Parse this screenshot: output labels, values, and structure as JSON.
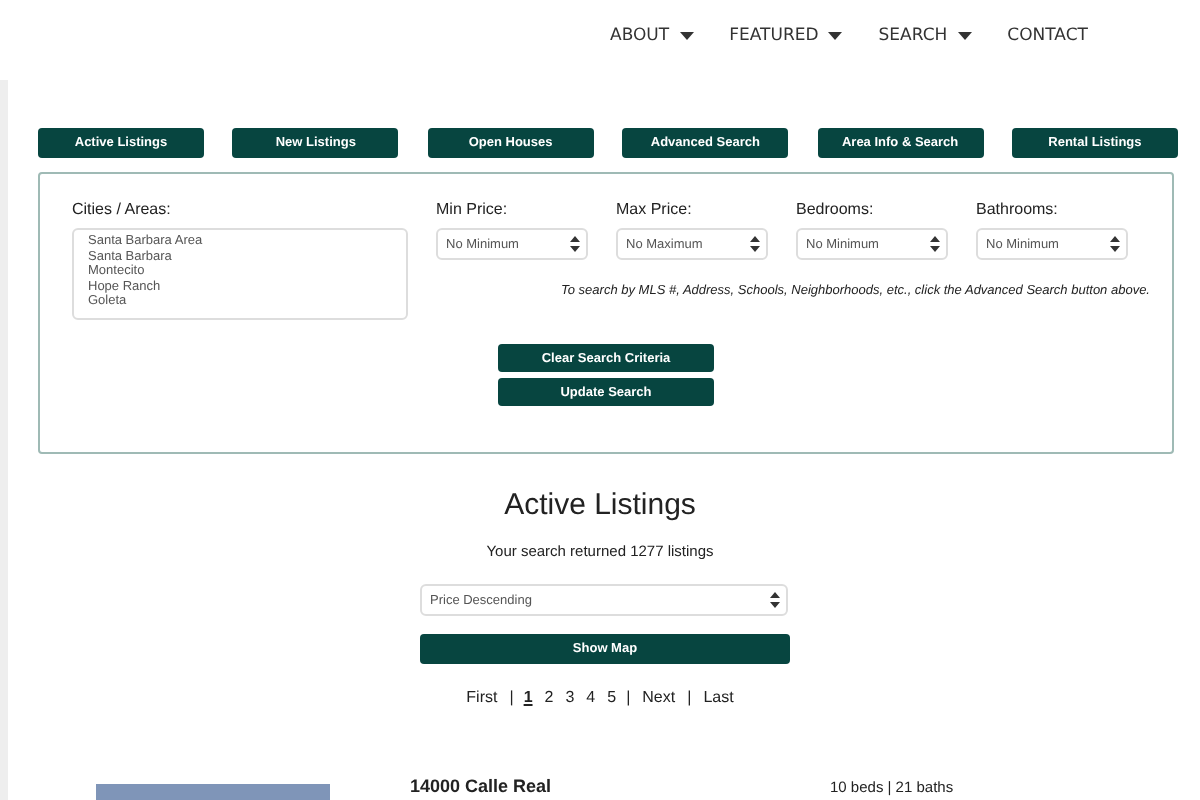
{
  "nav": [
    {
      "label": "ABOUT",
      "dropdown": true
    },
    {
      "label": "FEATURED",
      "dropdown": true
    },
    {
      "label": "SEARCH",
      "dropdown": true
    },
    {
      "label": "CONTACT",
      "dropdown": false
    }
  ],
  "tabs": [
    "Active Listings",
    "New Listings",
    "Open Houses",
    "Advanced Search",
    "Area Info & Search",
    "Rental Listings"
  ],
  "search": {
    "cities_label": "Cities / Areas:",
    "cities": [
      "Santa Barbara Area",
      "Santa Barbara",
      "Montecito",
      "Hope Ranch",
      "Goleta"
    ],
    "filters": [
      {
        "label": "Min Price:",
        "value": "No Minimum"
      },
      {
        "label": "Max Price:",
        "value": "No Maximum"
      },
      {
        "label": "Bedrooms:",
        "value": "No Minimum"
      },
      {
        "label": "Bathrooms:",
        "value": "No Minimum"
      }
    ],
    "note": "To search by MLS #, Address, Schools, Neighborhoods, etc., click the Advanced Search button above.",
    "buttons": [
      "Clear Search Criteria",
      "Update Search"
    ]
  },
  "results": {
    "title": "Active Listings",
    "summary": "Your search returned 1277 listings",
    "sort": "Price Descending",
    "map_button": "Show Map",
    "pager": [
      {
        "label": "First",
        "kind": "link"
      },
      {
        "label": "|",
        "kind": "sep"
      },
      {
        "label": "1",
        "kind": "page",
        "selected": true
      },
      {
        "label": "2",
        "kind": "page",
        "selected": false
      },
      {
        "label": "3",
        "kind": "page",
        "selected": false
      },
      {
        "label": "4",
        "kind": "page",
        "selected": false
      },
      {
        "label": "5",
        "kind": "page",
        "selected": false
      },
      {
        "label": "|",
        "kind": "sep"
      },
      {
        "label": "Next",
        "kind": "link"
      },
      {
        "label": "|",
        "kind": "sep"
      },
      {
        "label": "Last",
        "kind": "link"
      }
    ]
  },
  "listing": {
    "address": "14000 Calle Real",
    "details": "10 beds | 21 baths"
  }
}
